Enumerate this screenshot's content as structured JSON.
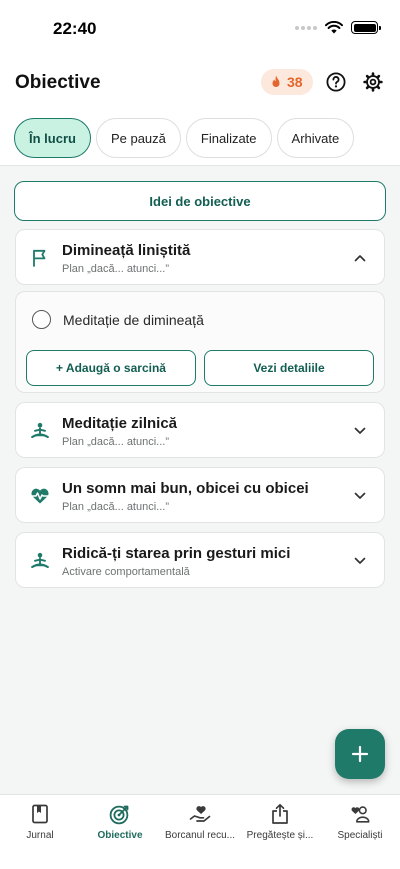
{
  "status_bar": {
    "time": "22:40"
  },
  "header": {
    "title": "Obiective",
    "streak_count": "38",
    "icons": [
      "fire-icon",
      "help-icon",
      "gear-icon"
    ]
  },
  "tabs": [
    {
      "label": "În lucru",
      "active": true
    },
    {
      "label": "Pe pauză",
      "active": false
    },
    {
      "label": "Finalizate",
      "active": false
    },
    {
      "label": "Arhivate",
      "active": false
    }
  ],
  "ideas_button": "Idei de obiective",
  "goals": [
    {
      "title": "Dimineață liniștită",
      "subtitle": "Plan „dacă... atunci...”",
      "icon": "flag-icon",
      "expanded": true
    },
    {
      "title": "Meditație zilnică",
      "subtitle": "Plan „dacă... atunci...”",
      "icon": "meditation-icon",
      "expanded": false
    },
    {
      "title": "Un somn mai bun, obicei cu obicei",
      "subtitle": "Plan „dacă... atunci...”",
      "icon": "heartbeat-icon",
      "expanded": false
    },
    {
      "title": "Ridică-ți starea prin gesturi mici",
      "subtitle": "Activare comportamentală",
      "icon": "meditation-icon",
      "expanded": false
    }
  ],
  "expanded_goal": {
    "task": "Meditație de dimineață",
    "add_task_label": "+ Adaugă o sarcină",
    "details_label": "Vezi detaliile"
  },
  "bottom_nav": [
    {
      "label": "Jurnal",
      "icon": "journal-icon",
      "active": false
    },
    {
      "label": "Obiective",
      "icon": "target-icon",
      "active": true
    },
    {
      "label": "Borcanul recu...",
      "icon": "jar-heart-icon",
      "active": false
    },
    {
      "label": "Pregătește și...",
      "icon": "share-icon",
      "active": false
    },
    {
      "label": "Specialiști",
      "icon": "specialists-icon",
      "active": false
    }
  ],
  "colors": {
    "accent": "#1f7a6a",
    "accent_light": "#c9f2e3",
    "streak": "#e3672c"
  }
}
